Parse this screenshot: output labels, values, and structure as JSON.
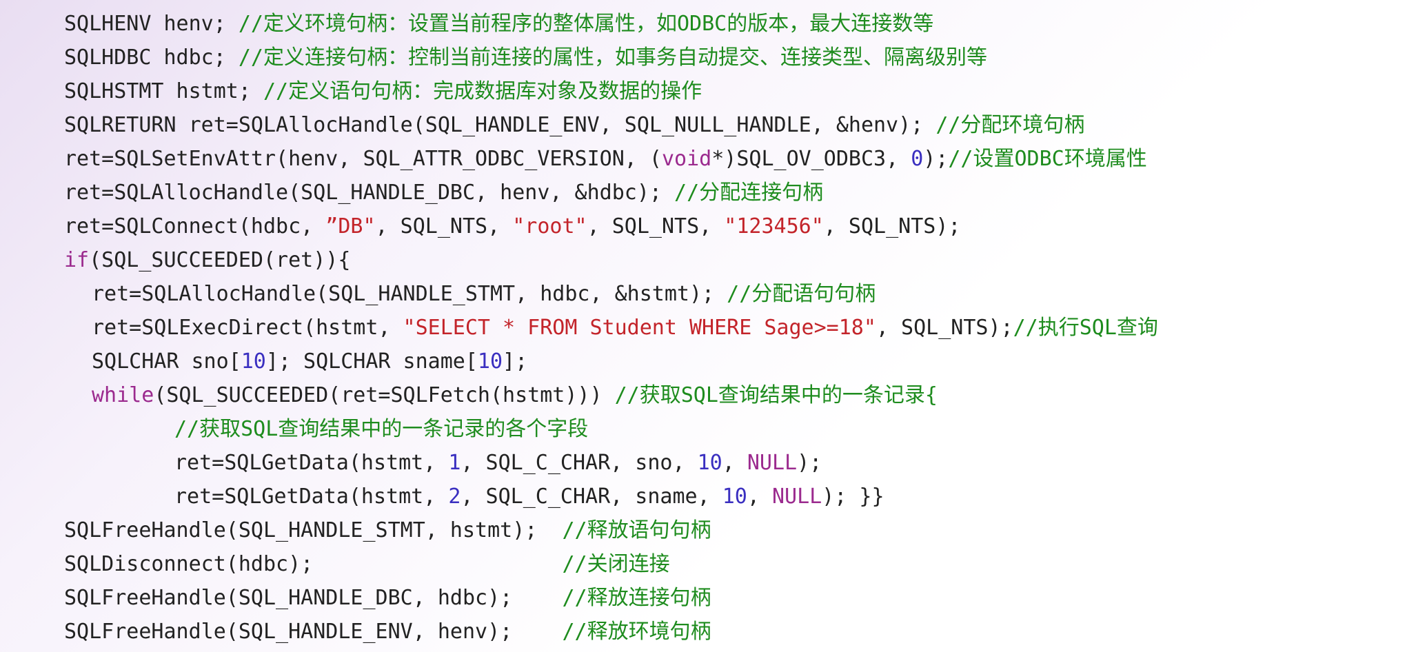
{
  "colors": {
    "plain": "#222222",
    "comment": "#1e8c1e",
    "string": "#c3242a",
    "keyword": "#9b2a8e",
    "number": "#3a2fc0"
  },
  "lines": [
    {
      "indent": 0,
      "tokens": [
        {
          "t": "plain",
          "v": "SQLHENV henv; "
        },
        {
          "t": "comment",
          "v": "//定义环境句柄：设置当前程序的整体属性，如ODBC的版本，最大连接数等"
        }
      ]
    },
    {
      "indent": 0,
      "tokens": [
        {
          "t": "plain",
          "v": "SQLHDBC hdbc; "
        },
        {
          "t": "comment",
          "v": "//定义连接句柄：控制当前连接的属性，如事务自动提交、连接类型、隔离级别等"
        }
      ]
    },
    {
      "indent": 0,
      "tokens": [
        {
          "t": "plain",
          "v": "SQLHSTMT hstmt; "
        },
        {
          "t": "comment",
          "v": "//定义语句句柄：完成数据库对象及数据的操作"
        }
      ]
    },
    {
      "indent": 0,
      "tokens": [
        {
          "t": "plain",
          "v": "SQLRETURN ret=SQLAllocHandle(SQL_HANDLE_ENV, SQL_NULL_HANDLE, &henv); "
        },
        {
          "t": "comment",
          "v": "//分配环境句柄"
        }
      ]
    },
    {
      "indent": 0,
      "tokens": [
        {
          "t": "plain",
          "v": "ret=SQLSetEnvAttr(henv, SQL_ATTR_ODBC_VERSION, ("
        },
        {
          "t": "keyword",
          "v": "void"
        },
        {
          "t": "plain",
          "v": "*)SQL_OV_ODBC3, "
        },
        {
          "t": "number",
          "v": "0"
        },
        {
          "t": "plain",
          "v": ");"
        },
        {
          "t": "comment",
          "v": "//设置ODBC环境属性"
        }
      ]
    },
    {
      "indent": 0,
      "tokens": [
        {
          "t": "plain",
          "v": "ret=SQLAllocHandle(SQL_HANDLE_DBC, henv, &hdbc); "
        },
        {
          "t": "comment",
          "v": "//分配连接句柄"
        }
      ]
    },
    {
      "indent": 0,
      "tokens": [
        {
          "t": "plain",
          "v": "ret=SQLConnect(hdbc, "
        },
        {
          "t": "string",
          "v": "”DB\""
        },
        {
          "t": "plain",
          "v": ", SQL_NTS, "
        },
        {
          "t": "string",
          "v": "\"root\""
        },
        {
          "t": "plain",
          "v": ", SQL_NTS, "
        },
        {
          "t": "string",
          "v": "\"123456\""
        },
        {
          "t": "plain",
          "v": ", SQL_NTS);"
        }
      ]
    },
    {
      "indent": 0,
      "tokens": [
        {
          "t": "keyword",
          "v": "if"
        },
        {
          "t": "plain",
          "v": "(SQL_SUCCEEDED(ret)){"
        }
      ]
    },
    {
      "indent": 1,
      "tokens": [
        {
          "t": "plain",
          "v": "ret=SQLAllocHandle(SQL_HANDLE_STMT, hdbc, &hstmt); "
        },
        {
          "t": "comment",
          "v": "//分配语句句柄"
        }
      ]
    },
    {
      "indent": 1,
      "tokens": [
        {
          "t": "plain",
          "v": "ret=SQLExecDirect(hstmt, "
        },
        {
          "t": "string",
          "v": "\"SELECT * FROM Student WHERE Sage>=18\""
        },
        {
          "t": "plain",
          "v": ", SQL_NTS);"
        },
        {
          "t": "comment",
          "v": "//执行SQL查询"
        }
      ]
    },
    {
      "indent": 1,
      "tokens": [
        {
          "t": "plain",
          "v": "SQLCHAR sno["
        },
        {
          "t": "number",
          "v": "10"
        },
        {
          "t": "plain",
          "v": "]; SQLCHAR sname["
        },
        {
          "t": "number",
          "v": "10"
        },
        {
          "t": "plain",
          "v": "];"
        }
      ]
    },
    {
      "indent": 1,
      "tokens": [
        {
          "t": "keyword",
          "v": "while"
        },
        {
          "t": "plain",
          "v": "(SQL_SUCCEEDED(ret=SQLFetch(hstmt))) "
        },
        {
          "t": "comment",
          "v": "//获取SQL查询结果中的一条记录{"
        }
      ]
    },
    {
      "indent": 2,
      "tokens": [
        {
          "t": "comment",
          "v": "//获取SQL查询结果中的一条记录的各个字段"
        }
      ]
    },
    {
      "indent": 2,
      "tokens": [
        {
          "t": "plain",
          "v": "ret=SQLGetData(hstmt, "
        },
        {
          "t": "number",
          "v": "1"
        },
        {
          "t": "plain",
          "v": ", SQL_C_CHAR, sno, "
        },
        {
          "t": "number",
          "v": "10"
        },
        {
          "t": "plain",
          "v": ", "
        },
        {
          "t": "keyword",
          "v": "NULL"
        },
        {
          "t": "plain",
          "v": ");"
        }
      ]
    },
    {
      "indent": 2,
      "tokens": [
        {
          "t": "plain",
          "v": "ret=SQLGetData(hstmt, "
        },
        {
          "t": "number",
          "v": "2"
        },
        {
          "t": "plain",
          "v": ", SQL_C_CHAR, sname, "
        },
        {
          "t": "number",
          "v": "10"
        },
        {
          "t": "plain",
          "v": ", "
        },
        {
          "t": "keyword",
          "v": "NULL"
        },
        {
          "t": "plain",
          "v": "); }}"
        }
      ]
    },
    {
      "indent": 0,
      "tokens": [
        {
          "t": "plain",
          "v": "SQLFreeHandle(SQL_HANDLE_STMT, hstmt);  "
        },
        {
          "t": "comment",
          "v": "//释放语句句柄"
        }
      ]
    },
    {
      "indent": 0,
      "tokens": [
        {
          "t": "plain",
          "v": "SQLDisconnect(hdbc);                    "
        },
        {
          "t": "comment",
          "v": "//关闭连接"
        }
      ]
    },
    {
      "indent": 0,
      "tokens": [
        {
          "t": "plain",
          "v": "SQLFreeHandle(SQL_HANDLE_DBC, hdbc);    "
        },
        {
          "t": "comment",
          "v": "//释放连接句柄"
        }
      ]
    },
    {
      "indent": 0,
      "tokens": [
        {
          "t": "plain",
          "v": "SQLFreeHandle(SQL_HANDLE_ENV, henv);    "
        },
        {
          "t": "comment",
          "v": "//释放环境句柄"
        }
      ]
    }
  ]
}
